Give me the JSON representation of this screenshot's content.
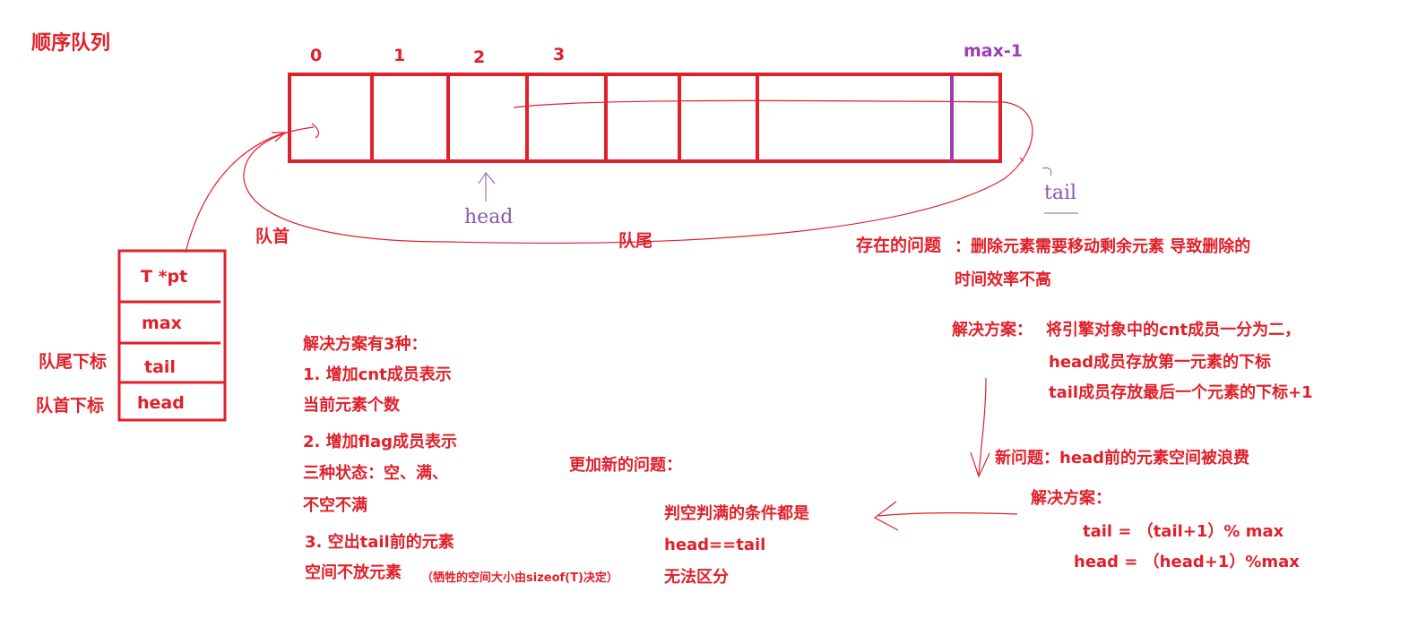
{
  "title": "顺序队列",
  "array": {
    "index_labels": [
      "0",
      "1",
      "2",
      "3"
    ],
    "last_index_label": "max-1"
  },
  "hand_labels": {
    "head": "head",
    "tail": "tail"
  },
  "flow_labels": {
    "queue_front": "队首",
    "queue_rear": "队尾"
  },
  "struct_box": {
    "fields": [
      "T *pt",
      "max",
      "tail",
      "head"
    ],
    "tail_side_label": "队尾下标",
    "head_side_label": "队首下标"
  },
  "problem": {
    "label": "存在的问题",
    "line1": "：删除元素需要移动剩余元素 导致删除的",
    "line2": "时间效率不高"
  },
  "solution1": {
    "label": "解决方案：",
    "line1": "将引擎对象中的cnt成员一分为二，",
    "line2": "head成员存放第一元素的下标",
    "line3": "tail成员存放最后一个元素的下标+1"
  },
  "new_problem": "新问题：head前的元素空间被浪费",
  "solution2": {
    "label": "解决方案：",
    "formula1": "tail =  （tail+1）% max",
    "formula2": "head =  （head+1）%max"
  },
  "further_problem": {
    "title": "更加新的问题：",
    "line1": "判空判满的条件都是",
    "line2": "head==tail",
    "line3": "无法区分"
  },
  "three_solutions": {
    "title": "解决方案有3种：",
    "s1_line1": "1. 增加cnt成员表示",
    "s1_line2": "当前元素个数",
    "s2_line1": "2. 增加flag成员表示",
    "s2_line2": "三种状态：空、满、",
    "s2_line3": "不空不满",
    "s3_line1": "3. 空出tail前的元素",
    "s3_line2": "空间不放元素",
    "s3_note": "（牺牲的空间大小由sizeof(T)决定）"
  },
  "colors": {
    "red": "#e0202a",
    "purple": "#9b3fb5",
    "pencil": "#8a5aa8"
  }
}
